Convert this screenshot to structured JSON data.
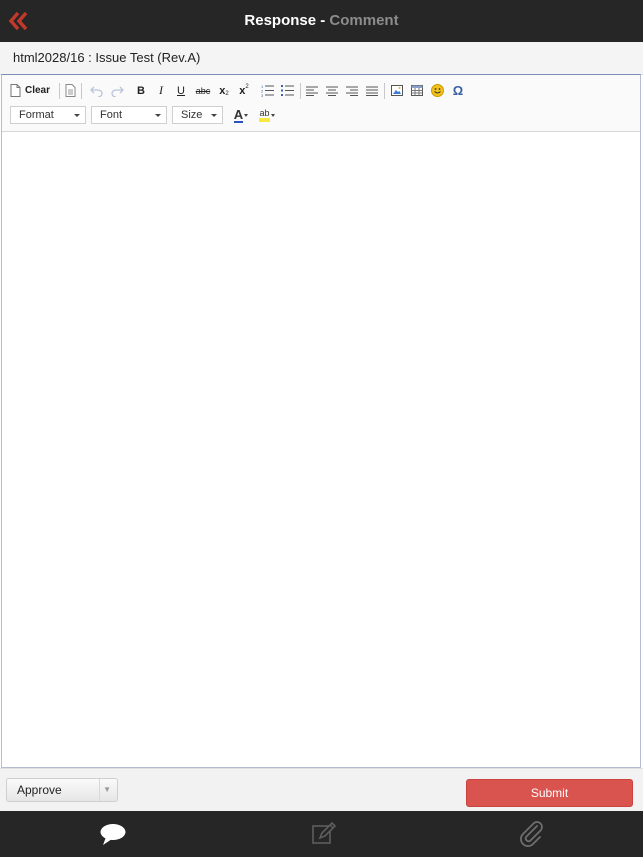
{
  "topbar": {
    "title_main": "Response - ",
    "title_sub": "Comment",
    "back_icon": "double-chevron-left-icon"
  },
  "document": {
    "title": "html2028/16 : Issue Test (Rev.A)"
  },
  "toolbar": {
    "clear_label": "Clear",
    "format_label": "Format",
    "font_label": "Font",
    "size_label": "Size",
    "buttons": [
      "new-page-icon",
      "templates-icon",
      "undo-icon",
      "redo-icon",
      "bold-icon",
      "italic-icon",
      "underline-icon",
      "strikethrough-icon",
      "subscript-icon",
      "superscript-icon",
      "numbered-list-icon",
      "bulleted-list-icon",
      "align-left-icon",
      "align-center-icon",
      "align-right-icon",
      "justify-icon",
      "image-icon",
      "table-icon",
      "smiley-icon",
      "special-char-icon",
      "text-color-icon",
      "background-color-icon"
    ],
    "glyphs": {
      "bold": "B",
      "italic": "I",
      "underline": "U",
      "strike": "abc",
      "sub": "x",
      "sub_index": "2",
      "sup": "x",
      "sup_index": "2",
      "omega": "Ω",
      "text_color": "A",
      "bg_color": "ab"
    }
  },
  "editor": {
    "content": ""
  },
  "footer": {
    "status_value": "Approve",
    "submit_label": "Submit"
  },
  "tabs": [
    "comment-icon",
    "edit-icon",
    "attachment-icon"
  ],
  "colors": {
    "accent": "#d9534f",
    "topbar": "#262626",
    "back_icon": "#c0392b"
  }
}
